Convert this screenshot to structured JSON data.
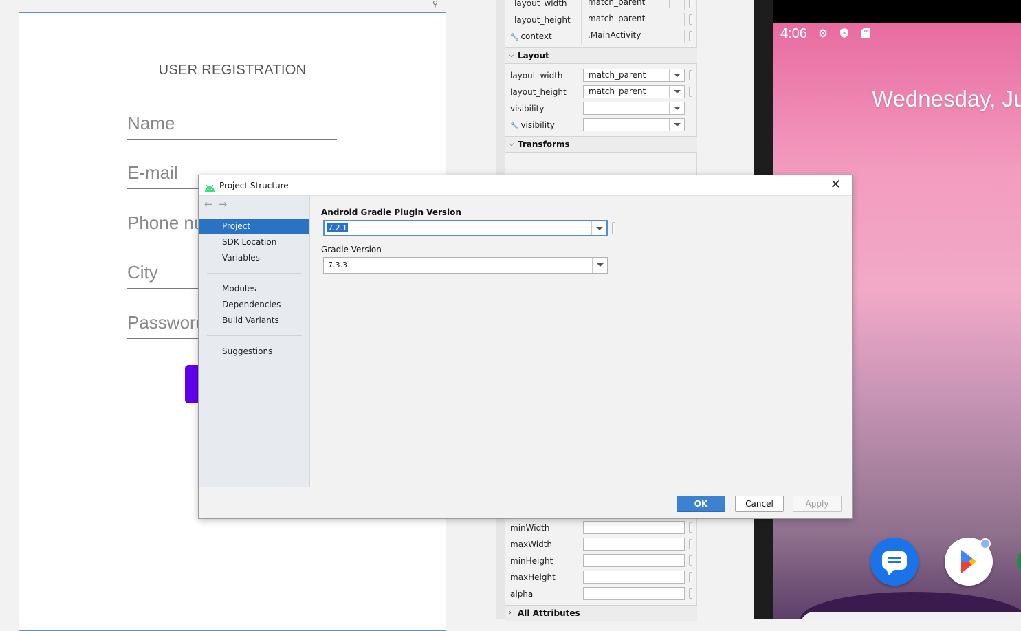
{
  "designer": {
    "title": "USER REGISTRATION",
    "fields": [
      "Name",
      "E-mail",
      "Phone number",
      "City",
      "Password"
    ]
  },
  "attributes": {
    "top_rows": [
      {
        "name": "layout_width",
        "value": "match_parent",
        "kind": "combo"
      },
      {
        "name": "layout_height",
        "value": "match_parent",
        "kind": "combo"
      },
      {
        "name": "context",
        "value": ".MainActivity",
        "kind": "plain",
        "wrench": true
      }
    ],
    "layout_section": "Layout",
    "layout_rows": [
      {
        "name": "layout_width",
        "value": "match_parent"
      },
      {
        "name": "layout_height",
        "value": "match_parent"
      },
      {
        "name": "visibility",
        "value": ""
      },
      {
        "name": "visibility",
        "value": "",
        "wrench": true
      }
    ],
    "transforms_section": "Transforms",
    "lower_rows": [
      "minWidth",
      "maxWidth",
      "minHeight",
      "maxHeight",
      "alpha"
    ],
    "all_attributes_section": "All Attributes"
  },
  "emulator": {
    "time": "4:06",
    "date": "Wednesday, Ju",
    "status_icons": [
      "gear-icon",
      "shield-play-icon",
      "sd-card-icon"
    ],
    "dock_icons": [
      "messages-icon",
      "play-store-icon"
    ]
  },
  "dialog": {
    "title": "Project Structure",
    "nav_items": [
      "Project",
      "SDK Location",
      "Variables",
      "Modules",
      "Dependencies",
      "Build Variants",
      "Suggestions"
    ],
    "selected_nav": "Project",
    "agp_label": "Android Gradle Plugin Version",
    "agp_value": "7.2.1",
    "gradle_label": "Gradle Version",
    "gradle_value": "7.3.3",
    "buttons": {
      "ok": "OK",
      "cancel": "Cancel",
      "apply": "Apply"
    }
  },
  "colors": {
    "accent": "#2a73c4",
    "registration_button": "#6200ee"
  }
}
